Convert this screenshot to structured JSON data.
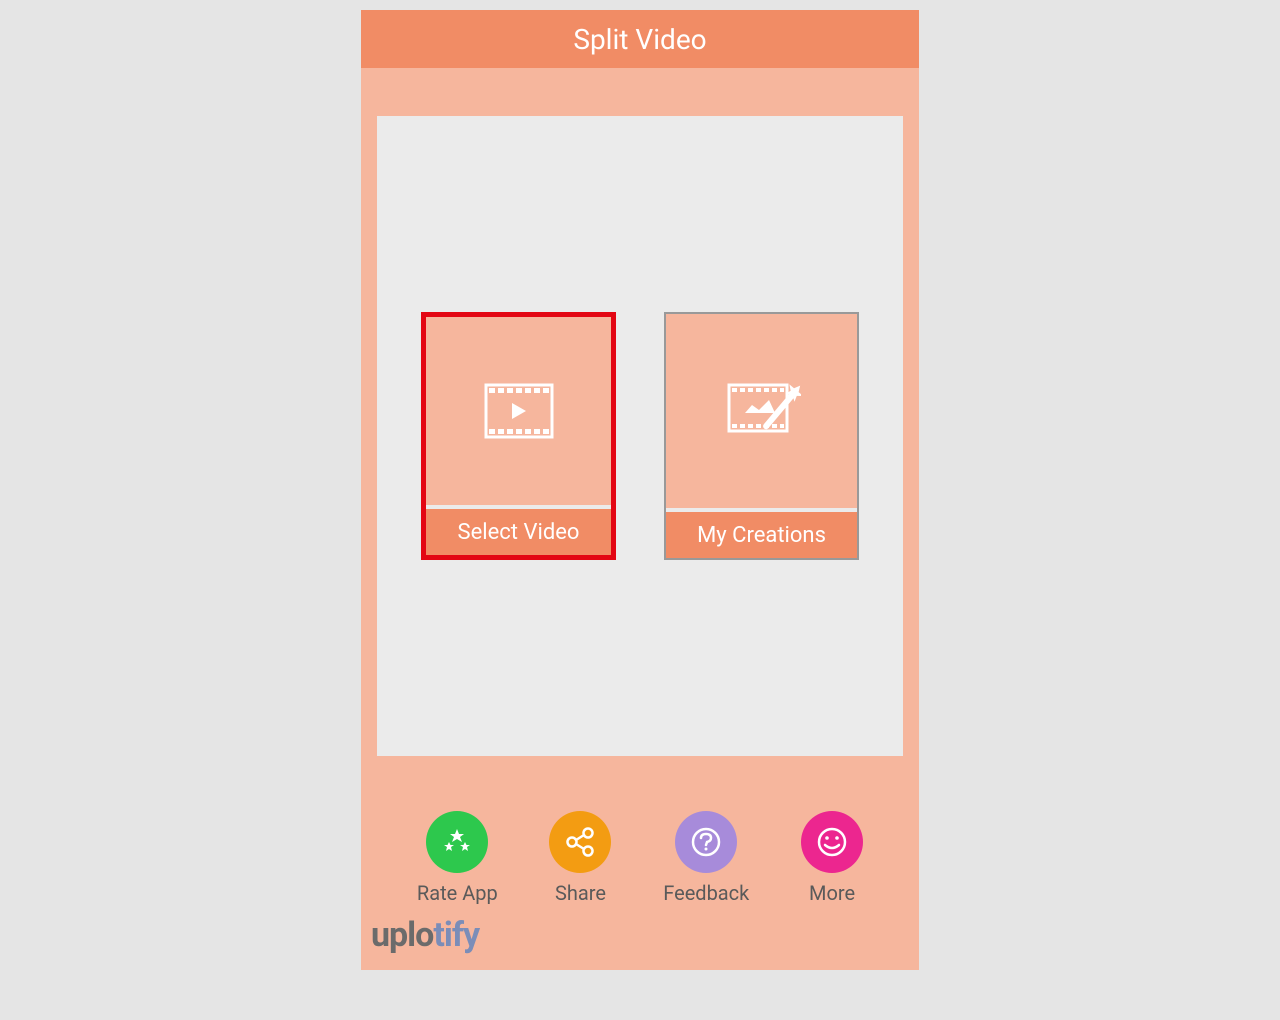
{
  "header": {
    "title": "Split Video"
  },
  "options": {
    "selectVideo": {
      "label": "Select Video",
      "iconName": "film-play-icon"
    },
    "myCreations": {
      "label": "My Creations",
      "iconName": "film-wand-icon"
    }
  },
  "bottomNav": {
    "rateApp": {
      "label": "Rate App",
      "color": "#2dc84d"
    },
    "share": {
      "label": "Share",
      "color": "#f39c12"
    },
    "feedback": {
      "label": "Feedback",
      "color": "#a78bda"
    },
    "more": {
      "label": "More",
      "color": "#ec268f"
    }
  },
  "watermark": {
    "part1": "uplo",
    "part2": "tify"
  }
}
